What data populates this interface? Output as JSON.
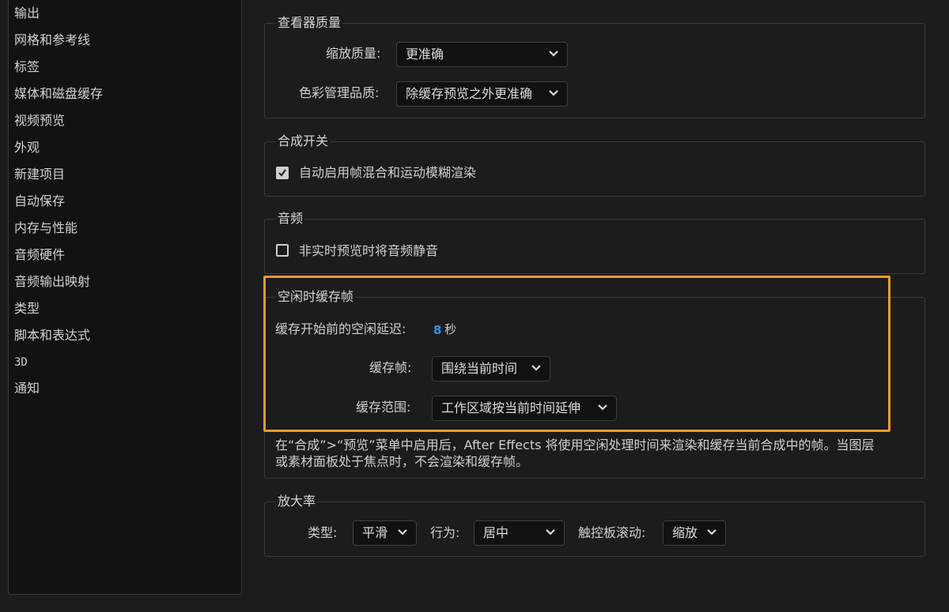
{
  "sidebar": {
    "items": [
      {
        "label": "输出"
      },
      {
        "label": "网格和参考线"
      },
      {
        "label": "标签"
      },
      {
        "label": "媒体和磁盘缓存"
      },
      {
        "label": "视频预览"
      },
      {
        "label": "外观"
      },
      {
        "label": "新建项目"
      },
      {
        "label": "自动保存"
      },
      {
        "label": "内存与性能"
      },
      {
        "label": "音频硬件"
      },
      {
        "label": "音频输出映射"
      },
      {
        "label": "类型"
      },
      {
        "label": "脚本和表达式"
      },
      {
        "label": "3D"
      },
      {
        "label": "通知"
      }
    ]
  },
  "viewer_quality": {
    "title": "查看器质量",
    "zoom_quality_label": "缩放质量:",
    "zoom_quality_value": "更准确",
    "color_mgmt_label": "色彩管理品质:",
    "color_mgmt_value": "除缓存预览之外更准确"
  },
  "comp_switches": {
    "title": "合成开关",
    "auto_enable_label": "自动启用帧混合和运动模糊渲染",
    "auto_enable_checked": true
  },
  "audio": {
    "title": "音频",
    "mute_label": "非实时预览时将音频静音",
    "mute_checked": false
  },
  "idle_cache": {
    "title": "空闲时缓存帧",
    "delay_label": "缓存开始前的空闲延迟:",
    "delay_value": "8",
    "delay_unit": "秒",
    "cache_frames_label": "缓存帧:",
    "cache_frames_value": "围绕当前时间",
    "cache_range_label": "缓存范围:",
    "cache_range_value": "工作区域按当前时间延伸",
    "description": "在“合成”>“预览”菜单中启用后，After Effects 将使用空闲处理时间来渲染和缓存当前合成中的帧。当图层或素材面板处于焦点时，不会渲染和缓存帧。"
  },
  "magnification": {
    "title": "放大率",
    "type_label": "类型:",
    "type_value": "平滑",
    "behavior_label": "行为:",
    "behavior_value": "居中",
    "trackpad_label": "触控板滚动:",
    "trackpad_value": "缩放"
  },
  "colors": {
    "highlight": "#ef9a2c",
    "value_blue": "#3d8fe6"
  }
}
